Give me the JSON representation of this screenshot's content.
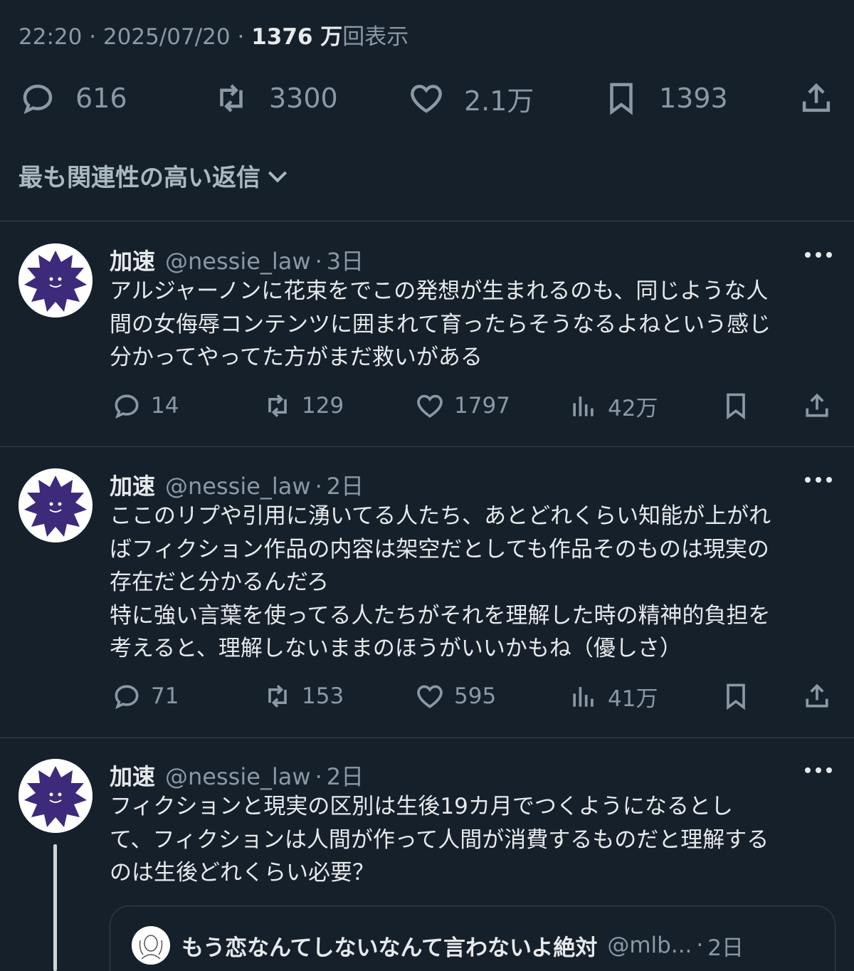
{
  "tweet_meta": {
    "time": "22:20",
    "date": "2025/07/20",
    "dot": "·",
    "views_count": "1376 万",
    "views_label": "回表示"
  },
  "main_actions": {
    "replies": "616",
    "retweets": "3300",
    "likes": "2.1万",
    "bookmarks": "1393"
  },
  "replies_section": {
    "title": "最も関連性の高い返信"
  },
  "replies": [
    {
      "name": "加速",
      "handle": "@nessie_law",
      "dot": "·",
      "time": "3日",
      "text": "アルジャーノンに花束をでこの発想が生まれるのも、同じような人\n間の女侮辱コンテンツに囲まれて育ったらそうなるよねという感じ\n分かってやってた方がまだ救いがある",
      "replies": "14",
      "retweets": "129",
      "likes": "1797",
      "views": "42万"
    },
    {
      "name": "加速",
      "handle": "@nessie_law",
      "dot": "·",
      "time": "2日",
      "text": "ここのリプや引用に湧いてる人たち、あとどれくらい知能が上がれ\nばフィクション作品の内容は架空だとしても作品そのものは現実の\n存在だと分かるんだろ\n特に強い言葉を使ってる人たちがそれを理解した時の精神的負担を\n考えると、理解しないままのほうがいいかもね（優しさ）",
      "replies": "71",
      "retweets": "153",
      "likes": "595",
      "views": "41万"
    },
    {
      "name": "加速",
      "handle": "@nessie_law",
      "dot": "·",
      "time": "2日",
      "text": "フィクションと現実の区別は生後19カ月でつくようになるとし\nて、フィクションは人間が作って人間が消費するものだと理解する\nのは生後どれくらい必要？"
    }
  ],
  "quoted_tweet": {
    "name": "もう恋なんてしないなんて言わないよ絶対",
    "handle": "@mlb...",
    "dot": "·",
    "time": "2日"
  },
  "colors": {
    "background": "#15202b",
    "text_primary": "#e7e9ea",
    "text_secondary": "#8b98a5",
    "divider": "#38444d",
    "avatar_blob": "#3d2a7a"
  },
  "icons": {
    "reply": "speech-bubble-icon",
    "retweet": "retweet-icon",
    "like": "heart-icon",
    "bookmark": "bookmark-icon",
    "share": "share-icon",
    "views": "bar-chart-icon",
    "more": "more-dots-icon",
    "chevron": "chevron-down-icon"
  }
}
